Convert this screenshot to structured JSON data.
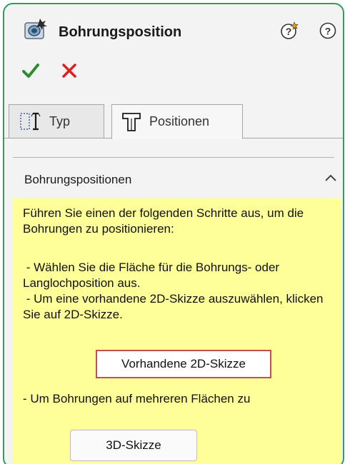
{
  "header": {
    "title": "Bohrungsposition",
    "icons": [
      "hole-wizard-icon",
      "whats-wrong-icon",
      "help-icon"
    ]
  },
  "actions": {
    "ok_icon": "checkmark-icon",
    "cancel_icon": "x-icon",
    "ok_color": "#2e8b2e",
    "cancel_color": "#e02020"
  },
  "tabs": [
    {
      "label": "Typ",
      "icon": "hole-type-icon",
      "active": false
    },
    {
      "label": "Positionen",
      "icon": "hole-position-icon",
      "active": true
    }
  ],
  "section": {
    "title": "Bohrungspositionen",
    "collapse_icon": "chevron-up-icon"
  },
  "info": {
    "paragraph1": "Führen Sie einen der folgenden Schritte aus, um die Bohrungen zu positionieren:",
    "paragraph2_line1": " - Wählen Sie die Fläche für die Bohrungs- oder Langlochposition aus.",
    "paragraph2_line2": " - Um eine vorhandene 2D-Skizze auszuwählen, klicken Sie auf 2D-Skizze.",
    "existing_sketch_button": "Vorhandene 2D-Skizze",
    "paragraph3": "- Um Bohrungen auf mehreren Flächen zu",
    "sketch3d_button": "3D-Skizze",
    "background": "#ffff99"
  },
  "colors": {
    "panel_border": "#2e9e5b",
    "highlight_border": "#c0504d"
  }
}
